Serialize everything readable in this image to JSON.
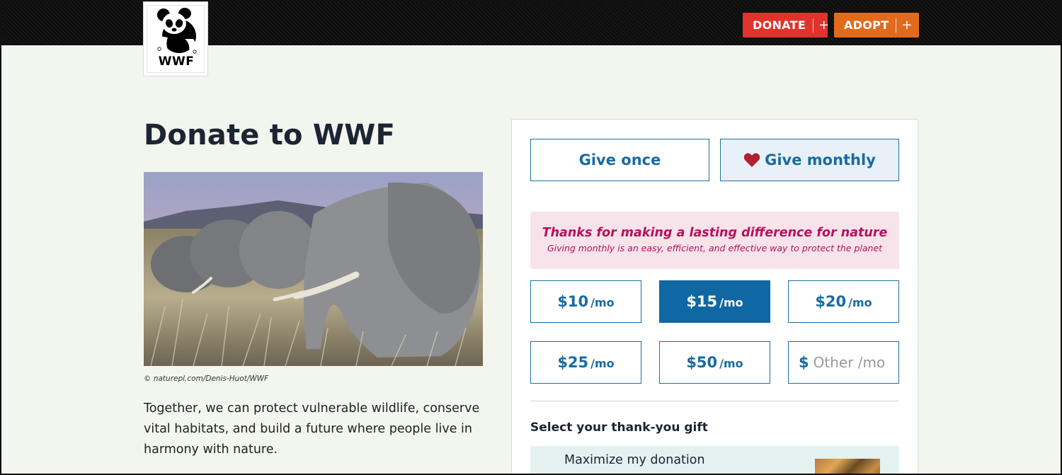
{
  "header": {
    "logo_text": "WWF",
    "donate_label": "DONATE",
    "adopt_label": "ADOPT",
    "plus": "+"
  },
  "main": {
    "title": "Donate to WWF",
    "photo_credit": "© naturepl.com/Denis-Huot/WWF",
    "intro": "Together, we can protect vulnerable wildlife, conserve vital habitats, and build a future where people live in harmony with nature."
  },
  "donation": {
    "frequency": {
      "once_label": "Give once",
      "monthly_label": "Give monthly",
      "selected": "monthly"
    },
    "message": {
      "title": "Thanks for making a lasting difference for nature",
      "subtitle": "Giving monthly is an easy, efficient, and effective way to protect the planet"
    },
    "amounts": [
      {
        "value": "$10",
        "per": "/mo"
      },
      {
        "value": "$15",
        "per": "/mo"
      },
      {
        "value": "$20",
        "per": "/mo"
      },
      {
        "value": "$25",
        "per": "/mo"
      },
      {
        "value": "$50",
        "per": "/mo"
      }
    ],
    "selected_amount": "$15",
    "other": {
      "currency": "$",
      "placeholder": "Other /mo"
    },
    "gift": {
      "heading": "Select your thank-you gift",
      "option_label": "Maximize my donation"
    }
  },
  "colors": {
    "primary_blue": "#0f67a3",
    "donate_red": "#e1322b",
    "adopt_orange": "#e26a1d",
    "message_pink": "#b5125a",
    "page_bg": "#f3f6ee"
  }
}
